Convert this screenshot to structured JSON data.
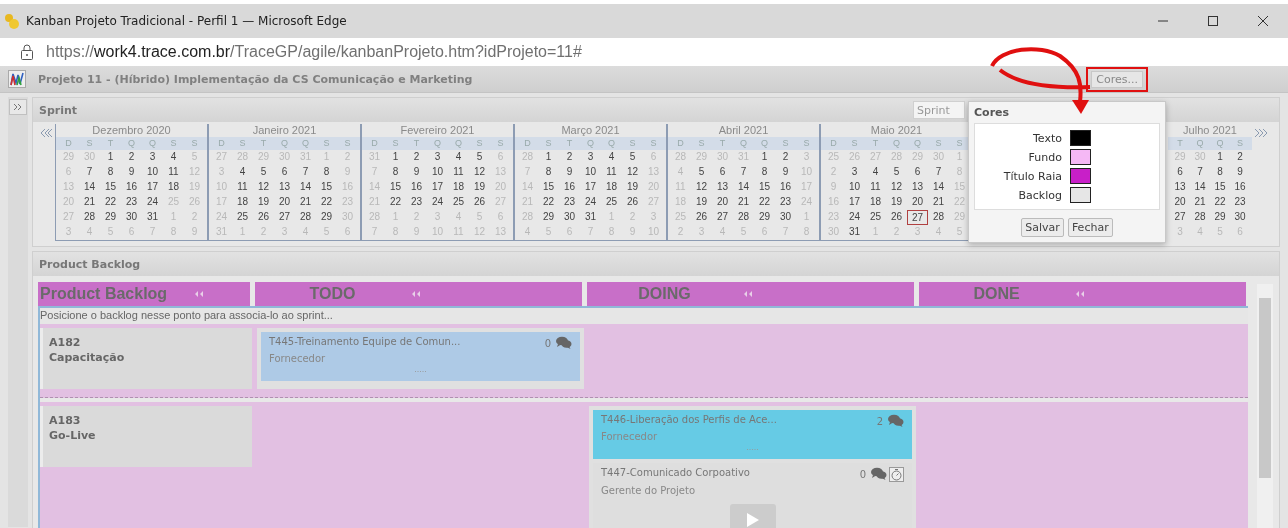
{
  "window": {
    "title": "Kanban Projeto Tradicional - Perfil 1 — Microsoft Edge"
  },
  "address_bar": {
    "scheme": "https://",
    "host": "work4.trace.com.br",
    "path": "/TraceGP/agile/kanbanProjeto.htm?idProjeto=11#"
  },
  "project": {
    "title": "Projeto 11 - (Híbrido) Implementação da CS Comunicação e Marketing",
    "colors_button": "Cores..."
  },
  "sprint": {
    "title": "Sprint",
    "search_placeholder": "Sprint",
    "months": [
      {
        "title": "Dezembro 2020",
        "weekdays": [
          "D",
          "S",
          "T",
          "Q",
          "Q",
          "S",
          "S"
        ],
        "weeks": [
          [
            {
              "d": "29",
              "muted": true,
              "selected": false
            },
            {
              "d": "30",
              "muted": true,
              "selected": false
            },
            {
              "d": "1",
              "muted": false,
              "selected": false
            },
            {
              "d": "2",
              "muted": false,
              "selected": false
            },
            {
              "d": "3",
              "muted": false,
              "selected": false
            },
            {
              "d": "4",
              "muted": false,
              "selected": false
            },
            {
              "d": "5",
              "muted": true,
              "selected": false
            }
          ],
          [
            {
              "d": "6",
              "muted": true,
              "selected": false
            },
            {
              "d": "7",
              "muted": false,
              "selected": false
            },
            {
              "d": "8",
              "muted": false,
              "selected": false
            },
            {
              "d": "9",
              "muted": false,
              "selected": false
            },
            {
              "d": "10",
              "muted": false,
              "selected": false
            },
            {
              "d": "11",
              "muted": false,
              "selected": false
            },
            {
              "d": "12",
              "muted": true,
              "selected": false
            }
          ],
          [
            {
              "d": "13",
              "muted": true,
              "selected": false
            },
            {
              "d": "14",
              "muted": false,
              "selected": false
            },
            {
              "d": "15",
              "muted": false,
              "selected": false
            },
            {
              "d": "16",
              "muted": false,
              "selected": false
            },
            {
              "d": "17",
              "muted": false,
              "selected": false
            },
            {
              "d": "18",
              "muted": false,
              "selected": false
            },
            {
              "d": "19",
              "muted": true,
              "selected": false
            }
          ],
          [
            {
              "d": "20",
              "muted": true,
              "selected": false
            },
            {
              "d": "21",
              "muted": false,
              "selected": false
            },
            {
              "d": "22",
              "muted": false,
              "selected": false
            },
            {
              "d": "23",
              "muted": false,
              "selected": false
            },
            {
              "d": "24",
              "muted": false,
              "selected": false
            },
            {
              "d": "25",
              "muted": true,
              "selected": false
            },
            {
              "d": "26",
              "muted": true,
              "selected": false
            }
          ],
          [
            {
              "d": "27",
              "muted": true,
              "selected": false
            },
            {
              "d": "28",
              "muted": false,
              "selected": false
            },
            {
              "d": "29",
              "muted": false,
              "selected": false
            },
            {
              "d": "30",
              "muted": false,
              "selected": false
            },
            {
              "d": "31",
              "muted": false,
              "selected": false
            },
            {
              "d": "1",
              "muted": true,
              "selected": false
            },
            {
              "d": "2",
              "muted": true,
              "selected": false
            }
          ],
          [
            {
              "d": "3",
              "muted": true,
              "selected": false
            },
            {
              "d": "4",
              "muted": true,
              "selected": false
            },
            {
              "d": "5",
              "muted": true,
              "selected": false
            },
            {
              "d": "6",
              "muted": true,
              "selected": false
            },
            {
              "d": "7",
              "muted": true,
              "selected": false
            },
            {
              "d": "8",
              "muted": true,
              "selected": false
            },
            {
              "d": "9",
              "muted": true,
              "selected": false
            }
          ]
        ]
      },
      {
        "title": "Janeiro 2021",
        "weekdays": [
          "D",
          "S",
          "T",
          "Q",
          "Q",
          "S",
          "S"
        ],
        "weeks": [
          [
            {
              "d": "27",
              "muted": true,
              "selected": false
            },
            {
              "d": "28",
              "muted": true,
              "selected": false
            },
            {
              "d": "29",
              "muted": true,
              "selected": false
            },
            {
              "d": "30",
              "muted": true,
              "selected": false
            },
            {
              "d": "31",
              "muted": true,
              "selected": false
            },
            {
              "d": "1",
              "muted": true,
              "selected": false
            },
            {
              "d": "2",
              "muted": true,
              "selected": false
            }
          ],
          [
            {
              "d": "3",
              "muted": true,
              "selected": false
            },
            {
              "d": "4",
              "muted": false,
              "selected": false
            },
            {
              "d": "5",
              "muted": false,
              "selected": false
            },
            {
              "d": "6",
              "muted": false,
              "selected": false
            },
            {
              "d": "7",
              "muted": false,
              "selected": false
            },
            {
              "d": "8",
              "muted": false,
              "selected": false
            },
            {
              "d": "9",
              "muted": true,
              "selected": false
            }
          ],
          [
            {
              "d": "10",
              "muted": true,
              "selected": false
            },
            {
              "d": "11",
              "muted": false,
              "selected": false
            },
            {
              "d": "12",
              "muted": false,
              "selected": false
            },
            {
              "d": "13",
              "muted": false,
              "selected": false
            },
            {
              "d": "14",
              "muted": false,
              "selected": false
            },
            {
              "d": "15",
              "muted": false,
              "selected": false
            },
            {
              "d": "16",
              "muted": true,
              "selected": false
            }
          ],
          [
            {
              "d": "17",
              "muted": true,
              "selected": false
            },
            {
              "d": "18",
              "muted": false,
              "selected": false
            },
            {
              "d": "19",
              "muted": false,
              "selected": false
            },
            {
              "d": "20",
              "muted": false,
              "selected": false
            },
            {
              "d": "21",
              "muted": false,
              "selected": false
            },
            {
              "d": "22",
              "muted": false,
              "selected": false
            },
            {
              "d": "23",
              "muted": true,
              "selected": false
            }
          ],
          [
            {
              "d": "24",
              "muted": true,
              "selected": false
            },
            {
              "d": "25",
              "muted": false,
              "selected": false
            },
            {
              "d": "26",
              "muted": false,
              "selected": false
            },
            {
              "d": "27",
              "muted": false,
              "selected": false
            },
            {
              "d": "28",
              "muted": false,
              "selected": false
            },
            {
              "d": "29",
              "muted": false,
              "selected": false
            },
            {
              "d": "30",
              "muted": true,
              "selected": false
            }
          ],
          [
            {
              "d": "31",
              "muted": true,
              "selected": false
            },
            {
              "d": "1",
              "muted": true,
              "selected": false
            },
            {
              "d": "2",
              "muted": true,
              "selected": false
            },
            {
              "d": "3",
              "muted": true,
              "selected": false
            },
            {
              "d": "4",
              "muted": true,
              "selected": false
            },
            {
              "d": "5",
              "muted": true,
              "selected": false
            },
            {
              "d": "6",
              "muted": true,
              "selected": false
            }
          ]
        ]
      },
      {
        "title": "Fevereiro 2021",
        "weekdays": [
          "D",
          "S",
          "T",
          "Q",
          "Q",
          "S",
          "S"
        ],
        "weeks": [
          [
            {
              "d": "31",
              "muted": true,
              "selected": false
            },
            {
              "d": "1",
              "muted": false,
              "selected": false
            },
            {
              "d": "2",
              "muted": false,
              "selected": false
            },
            {
              "d": "3",
              "muted": false,
              "selected": false
            },
            {
              "d": "4",
              "muted": false,
              "selected": false
            },
            {
              "d": "5",
              "muted": false,
              "selected": false
            },
            {
              "d": "6",
              "muted": true,
              "selected": false
            }
          ],
          [
            {
              "d": "7",
              "muted": true,
              "selected": false
            },
            {
              "d": "8",
              "muted": false,
              "selected": false
            },
            {
              "d": "9",
              "muted": false,
              "selected": false
            },
            {
              "d": "10",
              "muted": false,
              "selected": false
            },
            {
              "d": "11",
              "muted": false,
              "selected": false
            },
            {
              "d": "12",
              "muted": false,
              "selected": false
            },
            {
              "d": "13",
              "muted": true,
              "selected": false
            }
          ],
          [
            {
              "d": "14",
              "muted": true,
              "selected": false
            },
            {
              "d": "15",
              "muted": false,
              "selected": false
            },
            {
              "d": "16",
              "muted": false,
              "selected": false
            },
            {
              "d": "17",
              "muted": false,
              "selected": false
            },
            {
              "d": "18",
              "muted": false,
              "selected": false
            },
            {
              "d": "19",
              "muted": false,
              "selected": false
            },
            {
              "d": "20",
              "muted": true,
              "selected": false
            }
          ],
          [
            {
              "d": "21",
              "muted": true,
              "selected": false
            },
            {
              "d": "22",
              "muted": false,
              "selected": false
            },
            {
              "d": "23",
              "muted": false,
              "selected": false
            },
            {
              "d": "24",
              "muted": false,
              "selected": false
            },
            {
              "d": "25",
              "muted": false,
              "selected": false
            },
            {
              "d": "26",
              "muted": false,
              "selected": false
            },
            {
              "d": "27",
              "muted": true,
              "selected": false
            }
          ],
          [
            {
              "d": "28",
              "muted": true,
              "selected": false
            },
            {
              "d": "1",
              "muted": true,
              "selected": false
            },
            {
              "d": "2",
              "muted": true,
              "selected": false
            },
            {
              "d": "3",
              "muted": true,
              "selected": false
            },
            {
              "d": "4",
              "muted": true,
              "selected": false
            },
            {
              "d": "5",
              "muted": true,
              "selected": false
            },
            {
              "d": "6",
              "muted": true,
              "selected": false
            }
          ],
          [
            {
              "d": "7",
              "muted": true,
              "selected": false
            },
            {
              "d": "8",
              "muted": true,
              "selected": false
            },
            {
              "d": "9",
              "muted": true,
              "selected": false
            },
            {
              "d": "10",
              "muted": true,
              "selected": false
            },
            {
              "d": "11",
              "muted": true,
              "selected": false
            },
            {
              "d": "12",
              "muted": true,
              "selected": false
            },
            {
              "d": "13",
              "muted": true,
              "selected": false
            }
          ]
        ]
      },
      {
        "title": "Março 2021",
        "weekdays": [
          "D",
          "S",
          "T",
          "Q",
          "Q",
          "S",
          "S"
        ],
        "weeks": [
          [
            {
              "d": "28",
              "muted": true,
              "selected": false
            },
            {
              "d": "1",
              "muted": false,
              "selected": false
            },
            {
              "d": "2",
              "muted": false,
              "selected": false
            },
            {
              "d": "3",
              "muted": false,
              "selected": false
            },
            {
              "d": "4",
              "muted": false,
              "selected": false
            },
            {
              "d": "5",
              "muted": false,
              "selected": false
            },
            {
              "d": "6",
              "muted": true,
              "selected": false
            }
          ],
          [
            {
              "d": "7",
              "muted": true,
              "selected": false
            },
            {
              "d": "8",
              "muted": false,
              "selected": false
            },
            {
              "d": "9",
              "muted": false,
              "selected": false
            },
            {
              "d": "10",
              "muted": false,
              "selected": false
            },
            {
              "d": "11",
              "muted": false,
              "selected": false
            },
            {
              "d": "12",
              "muted": false,
              "selected": false
            },
            {
              "d": "13",
              "muted": true,
              "selected": false
            }
          ],
          [
            {
              "d": "14",
              "muted": true,
              "selected": false
            },
            {
              "d": "15",
              "muted": false,
              "selected": false
            },
            {
              "d": "16",
              "muted": false,
              "selected": false
            },
            {
              "d": "17",
              "muted": false,
              "selected": false
            },
            {
              "d": "18",
              "muted": false,
              "selected": false
            },
            {
              "d": "19",
              "muted": false,
              "selected": false
            },
            {
              "d": "20",
              "muted": true,
              "selected": false
            }
          ],
          [
            {
              "d": "21",
              "muted": true,
              "selected": false
            },
            {
              "d": "22",
              "muted": false,
              "selected": false
            },
            {
              "d": "23",
              "muted": false,
              "selected": false
            },
            {
              "d": "24",
              "muted": false,
              "selected": false
            },
            {
              "d": "25",
              "muted": false,
              "selected": false
            },
            {
              "d": "26",
              "muted": false,
              "selected": false
            },
            {
              "d": "27",
              "muted": true,
              "selected": false
            }
          ],
          [
            {
              "d": "28",
              "muted": true,
              "selected": false
            },
            {
              "d": "29",
              "muted": false,
              "selected": false
            },
            {
              "d": "30",
              "muted": false,
              "selected": false
            },
            {
              "d": "31",
              "muted": false,
              "selected": false
            },
            {
              "d": "1",
              "muted": true,
              "selected": false
            },
            {
              "d": "2",
              "muted": true,
              "selected": false
            },
            {
              "d": "3",
              "muted": true,
              "selected": false
            }
          ],
          [
            {
              "d": "4",
              "muted": true,
              "selected": false
            },
            {
              "d": "5",
              "muted": true,
              "selected": false
            },
            {
              "d": "6",
              "muted": true,
              "selected": false
            },
            {
              "d": "7",
              "muted": true,
              "selected": false
            },
            {
              "d": "8",
              "muted": true,
              "selected": false
            },
            {
              "d": "9",
              "muted": true,
              "selected": false
            },
            {
              "d": "10",
              "muted": true,
              "selected": false
            }
          ]
        ]
      },
      {
        "title": "Abril 2021",
        "weekdays": [
          "D",
          "S",
          "T",
          "Q",
          "Q",
          "S",
          "S"
        ],
        "weeks": [
          [
            {
              "d": "28",
              "muted": true,
              "selected": false
            },
            {
              "d": "29",
              "muted": true,
              "selected": false
            },
            {
              "d": "30",
              "muted": true,
              "selected": false
            },
            {
              "d": "31",
              "muted": true,
              "selected": false
            },
            {
              "d": "1",
              "muted": false,
              "selected": false
            },
            {
              "d": "2",
              "muted": false,
              "selected": false
            },
            {
              "d": "3",
              "muted": true,
              "selected": false
            }
          ],
          [
            {
              "d": "4",
              "muted": true,
              "selected": false
            },
            {
              "d": "5",
              "muted": false,
              "selected": false
            },
            {
              "d": "6",
              "muted": false,
              "selected": false
            },
            {
              "d": "7",
              "muted": false,
              "selected": false
            },
            {
              "d": "8",
              "muted": false,
              "selected": false
            },
            {
              "d": "9",
              "muted": false,
              "selected": false
            },
            {
              "d": "10",
              "muted": true,
              "selected": false
            }
          ],
          [
            {
              "d": "11",
              "muted": true,
              "selected": false
            },
            {
              "d": "12",
              "muted": false,
              "selected": false
            },
            {
              "d": "13",
              "muted": false,
              "selected": false
            },
            {
              "d": "14",
              "muted": false,
              "selected": false
            },
            {
              "d": "15",
              "muted": false,
              "selected": false
            },
            {
              "d": "16",
              "muted": false,
              "selected": false
            },
            {
              "d": "17",
              "muted": true,
              "selected": false
            }
          ],
          [
            {
              "d": "18",
              "muted": true,
              "selected": false
            },
            {
              "d": "19",
              "muted": false,
              "selected": false
            },
            {
              "d": "20",
              "muted": false,
              "selected": false
            },
            {
              "d": "21",
              "muted": false,
              "selected": false
            },
            {
              "d": "22",
              "muted": false,
              "selected": false
            },
            {
              "d": "23",
              "muted": false,
              "selected": false
            },
            {
              "d": "24",
              "muted": true,
              "selected": false
            }
          ],
          [
            {
              "d": "25",
              "muted": true,
              "selected": false
            },
            {
              "d": "26",
              "muted": false,
              "selected": false
            },
            {
              "d": "27",
              "muted": false,
              "selected": false
            },
            {
              "d": "28",
              "muted": false,
              "selected": false
            },
            {
              "d": "29",
              "muted": false,
              "selected": false
            },
            {
              "d": "30",
              "muted": false,
              "selected": false
            },
            {
              "d": "1",
              "muted": true,
              "selected": false
            }
          ],
          [
            {
              "d": "2",
              "muted": true,
              "selected": false
            },
            {
              "d": "3",
              "muted": true,
              "selected": false
            },
            {
              "d": "4",
              "muted": true,
              "selected": false
            },
            {
              "d": "5",
              "muted": true,
              "selected": false
            },
            {
              "d": "6",
              "muted": true,
              "selected": false
            },
            {
              "d": "7",
              "muted": true,
              "selected": false
            },
            {
              "d": "8",
              "muted": true,
              "selected": false
            }
          ]
        ]
      },
      {
        "title": "Maio 2021",
        "weekdays": [
          "D",
          "S",
          "T",
          "Q",
          "Q",
          "S",
          "S"
        ],
        "weeks": [
          [
            {
              "d": "25",
              "muted": true,
              "selected": false
            },
            {
              "d": "26",
              "muted": true,
              "selected": false
            },
            {
              "d": "27",
              "muted": true,
              "selected": false
            },
            {
              "d": "28",
              "muted": true,
              "selected": false
            },
            {
              "d": "29",
              "muted": true,
              "selected": false
            },
            {
              "d": "30",
              "muted": true,
              "selected": false
            },
            {
              "d": "1",
              "muted": true,
              "selected": false
            }
          ],
          [
            {
              "d": "2",
              "muted": true,
              "selected": false
            },
            {
              "d": "3",
              "muted": false,
              "selected": false
            },
            {
              "d": "4",
              "muted": false,
              "selected": false
            },
            {
              "d": "5",
              "muted": false,
              "selected": false
            },
            {
              "d": "6",
              "muted": false,
              "selected": false
            },
            {
              "d": "7",
              "muted": false,
              "selected": false
            },
            {
              "d": "8",
              "muted": true,
              "selected": false
            }
          ],
          [
            {
              "d": "9",
              "muted": true,
              "selected": false
            },
            {
              "d": "10",
              "muted": false,
              "selected": false
            },
            {
              "d": "11",
              "muted": false,
              "selected": false
            },
            {
              "d": "12",
              "muted": false,
              "selected": false
            },
            {
              "d": "13",
              "muted": false,
              "selected": false
            },
            {
              "d": "14",
              "muted": false,
              "selected": false
            },
            {
              "d": "15",
              "muted": true,
              "selected": false
            }
          ],
          [
            {
              "d": "16",
              "muted": true,
              "selected": false
            },
            {
              "d": "17",
              "muted": false,
              "selected": false
            },
            {
              "d": "18",
              "muted": false,
              "selected": false
            },
            {
              "d": "19",
              "muted": false,
              "selected": false
            },
            {
              "d": "20",
              "muted": false,
              "selected": false
            },
            {
              "d": "21",
              "muted": false,
              "selected": false
            },
            {
              "d": "22",
              "muted": true,
              "selected": false
            }
          ],
          [
            {
              "d": "23",
              "muted": true,
              "selected": false
            },
            {
              "d": "24",
              "muted": false,
              "selected": false
            },
            {
              "d": "25",
              "muted": false,
              "selected": false
            },
            {
              "d": "26",
              "muted": false,
              "selected": false
            },
            {
              "d": "27",
              "muted": false,
              "selected": true
            },
            {
              "d": "28",
              "muted": false,
              "selected": false
            },
            {
              "d": "29",
              "muted": true,
              "selected": false
            }
          ],
          [
            {
              "d": "30",
              "muted": true,
              "selected": false
            },
            {
              "d": "31",
              "muted": false,
              "selected": false
            },
            {
              "d": "1",
              "muted": true,
              "selected": false
            },
            {
              "d": "2",
              "muted": true,
              "selected": false
            },
            {
              "d": "3",
              "muted": true,
              "selected": false
            },
            {
              "d": "4",
              "muted": true,
              "selected": false
            },
            {
              "d": "5",
              "muted": true,
              "selected": false
            }
          ]
        ]
      },
      {
        "title": "Julho 2021",
        "weekdays": [
          "T",
          "Q",
          "Q",
          "S"
        ],
        "weeks": [
          [
            {
              "d": "29",
              "muted": true,
              "selected": false
            },
            {
              "d": "30",
              "muted": true,
              "selected": false
            },
            {
              "d": "1",
              "muted": false,
              "selected": false
            },
            {
              "d": "2",
              "muted": false,
              "selected": false
            }
          ],
          [
            {
              "d": "6",
              "muted": false,
              "selected": false
            },
            {
              "d": "7",
              "muted": false,
              "selected": false
            },
            {
              "d": "8",
              "muted": false,
              "selected": false
            },
            {
              "d": "9",
              "muted": false,
              "selected": false
            }
          ],
          [
            {
              "d": "13",
              "muted": false,
              "selected": false
            },
            {
              "d": "14",
              "muted": false,
              "selected": false
            },
            {
              "d": "15",
              "muted": false,
              "selected": false
            },
            {
              "d": "16",
              "muted": false,
              "selected": false
            }
          ],
          [
            {
              "d": "20",
              "muted": false,
              "selected": false
            },
            {
              "d": "21",
              "muted": false,
              "selected": false
            },
            {
              "d": "22",
              "muted": false,
              "selected": false
            },
            {
              "d": "23",
              "muted": false,
              "selected": false
            }
          ],
          [
            {
              "d": "27",
              "muted": false,
              "selected": false
            },
            {
              "d": "28",
              "muted": false,
              "selected": false
            },
            {
              "d": "29",
              "muted": false,
              "selected": false
            },
            {
              "d": "30",
              "muted": false,
              "selected": false
            }
          ],
          [
            {
              "d": "3",
              "muted": true,
              "selected": false
            },
            {
              "d": "4",
              "muted": true,
              "selected": false
            },
            {
              "d": "5",
              "muted": true,
              "selected": false
            },
            {
              "d": "6",
              "muted": true,
              "selected": false
            }
          ]
        ]
      }
    ]
  },
  "colors_popup": {
    "title": "Cores",
    "items": [
      {
        "label": "Texto",
        "color": "#000000"
      },
      {
        "label": "Fundo",
        "color": "#f5b8f5"
      },
      {
        "label": "Título Raia",
        "color": "#c81fc8"
      },
      {
        "label": "Backlog",
        "color": "#e6e6e6"
      }
    ],
    "buttons": [
      "Salvar",
      "Fechar"
    ]
  },
  "backlog": {
    "title": "Product Backlog",
    "lanes": [
      "Product Backlog",
      "TODO",
      "DOING",
      "DONE"
    ],
    "hint": "Posicione o backlog nesse ponto para associa-lo ao sprint...",
    "rows": [
      {
        "code": "A182",
        "name": "Capacitação",
        "cells": [
          {
            "cards": [
              {
                "kind": "summary",
                "title": "T445-Treinamento Equipe de Comun...",
                "role": "Fornecedor",
                "comments": "0",
                "more": ".....",
                "color": "#aecae6"
              }
            ]
          },
          {},
          {}
        ]
      },
      {
        "code": "A183",
        "name": "Go-Live",
        "cells": [
          {},
          {
            "cards": [
              {
                "kind": "summary",
                "title": "T446-Liberação dos Perfis de Ace...",
                "role": "Fornecedor",
                "comments": "2",
                "more": ".....",
                "color": "#66cbe5"
              },
              {
                "kind": "media",
                "title": "T447-Comunicado Corpoativo",
                "role": "Gerente do Projeto",
                "comments": "0",
                "color": "#dedede"
              }
            ]
          },
          {}
        ]
      }
    ]
  }
}
